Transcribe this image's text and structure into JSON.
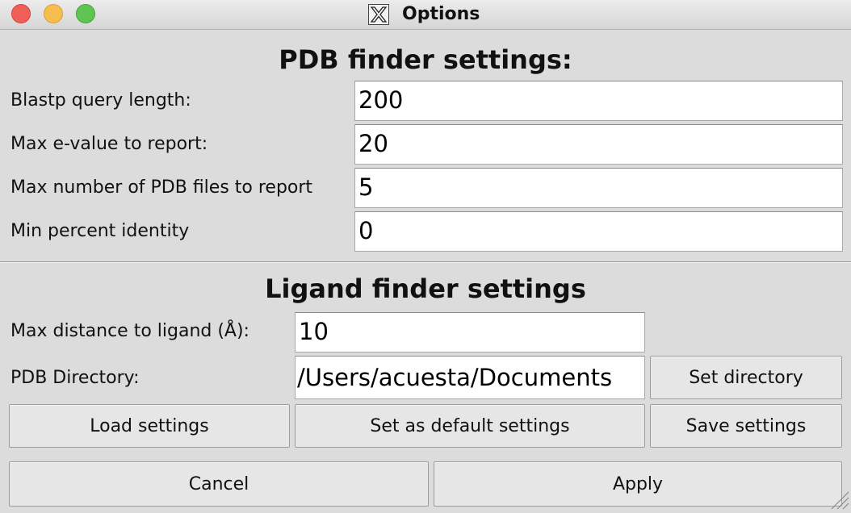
{
  "window": {
    "title": "Options"
  },
  "pdb_finder": {
    "heading": "PDB finder settings:",
    "blastp_label": "Blastp query length:",
    "blastp_value": "200",
    "evalue_label": "Max e-value to report:",
    "evalue_value": "20",
    "max_files_label": "Max number of PDB files to report",
    "max_files_value": "5",
    "identity_label": "Min percent identity",
    "identity_value": "0"
  },
  "ligand_finder": {
    "heading": "Ligand finder settings",
    "distance_label": "Max distance to ligand (Å):",
    "distance_value": "10",
    "directory_label": "PDB Directory:",
    "directory_value": "/Users/acuesta/Documents",
    "set_directory_label": "Set directory"
  },
  "actions": {
    "load_label": "Load settings",
    "default_label": "Set as default settings",
    "save_label": "Save settings",
    "cancel_label": "Cancel",
    "apply_label": "Apply"
  }
}
